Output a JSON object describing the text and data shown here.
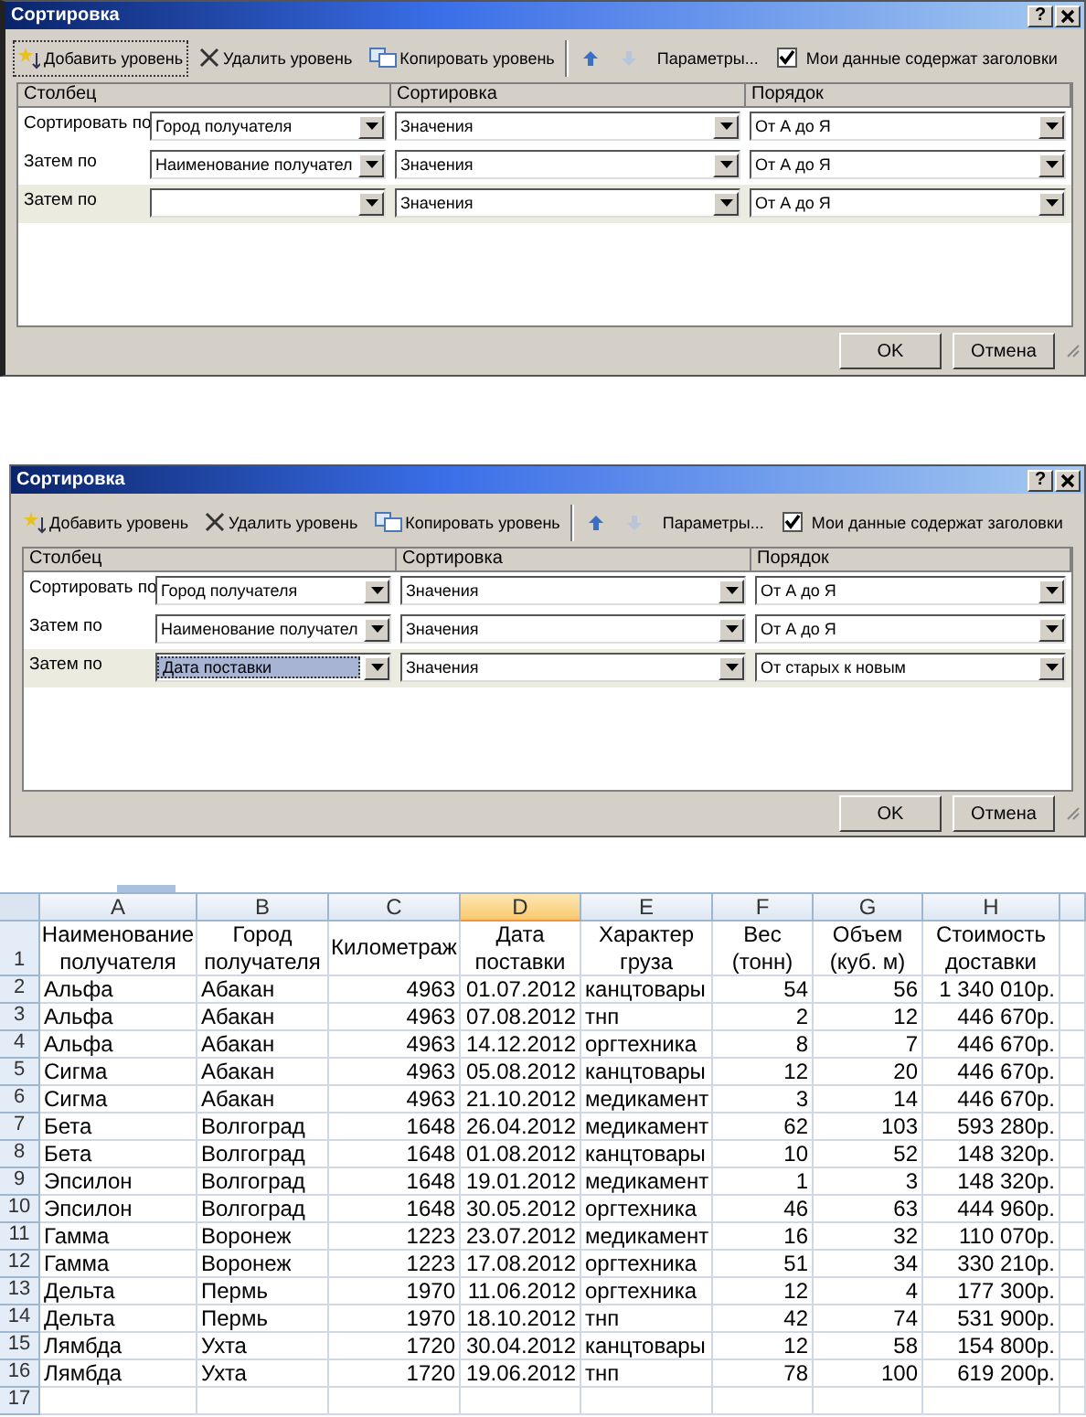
{
  "dialogs": [
    {
      "title": "Сортировка",
      "help": "?",
      "toolbar": [
        {
          "kind": "add",
          "label": "Добавить уровень",
          "focused": true
        },
        {
          "kind": "delete",
          "label": "Удалить уровень"
        },
        {
          "kind": "copy",
          "label": "Копировать уровень"
        },
        {
          "kind": "up",
          "disabled": false
        },
        {
          "kind": "down",
          "disabled": true
        },
        {
          "kind": "options",
          "label": "Параметры..."
        }
      ],
      "headers_checkbox": {
        "label": "Мои данные содержат заголовки",
        "checked": true
      },
      "columns": [
        "Столбец",
        "Сортировка",
        "Порядок"
      ],
      "levels": [
        {
          "label": "Сортировать по",
          "column": "Город получателя",
          "column_text_selected": false,
          "sort_on": "Значения",
          "order": "От А до Я",
          "selected": false
        },
        {
          "label": "Затем по",
          "column": "Наименование получател",
          "column_text_selected": false,
          "sort_on": "Значения",
          "order": "От А до Я",
          "selected": false
        },
        {
          "label": "Затем по",
          "column_text_selected": false,
          "sort_on": "Значения",
          "order": "От А до Я",
          "selected": true
        }
      ],
      "buttons": [
        "OK",
        "Отмена"
      ]
    },
    {
      "title": "Сортировка",
      "help": "?",
      "toolbar": [
        {
          "kind": "add",
          "label": "Добавить уровень",
          "focused": false
        },
        {
          "kind": "delete",
          "label": "Удалить уровень"
        },
        {
          "kind": "copy",
          "label": "Копировать уровень"
        },
        {
          "kind": "up",
          "disabled": false
        },
        {
          "kind": "down",
          "disabled": true
        },
        {
          "kind": "options",
          "label": "Параметры..."
        }
      ],
      "headers_checkbox": {
        "label": "Мои данные содержат заголовки",
        "checked": true
      },
      "columns": [
        "Столбец",
        "Сортировка",
        "Порядок"
      ],
      "levels": [
        {
          "label": "Сортировать по",
          "column": "Город получателя",
          "column_text_selected": false,
          "sort_on": "Значения",
          "order": "От А до Я",
          "selected": false
        },
        {
          "label": "Затем по",
          "column": "Наименование получател",
          "column_text_selected": false,
          "sort_on": "Значения",
          "order": "От А до Я",
          "selected": false
        },
        {
          "label": "Затем по",
          "column": "Дата поставки",
          "column_text_selected": true,
          "sort_on": "Значения",
          "order": "От старых к новым",
          "selected": true
        }
      ],
      "buttons": [
        "OK",
        "Отмена"
      ]
    }
  ],
  "sheet": {
    "columns": [
      {
        "letter": "A",
        "selected": false
      },
      {
        "letter": "B",
        "selected": false
      },
      {
        "letter": "C",
        "selected": false
      },
      {
        "letter": "D",
        "selected": true
      },
      {
        "letter": "E",
        "selected": false
      },
      {
        "letter": "F",
        "selected": false
      },
      {
        "letter": "G",
        "selected": false
      },
      {
        "letter": "H",
        "selected": false
      }
    ],
    "header_row": {
      "number": "1",
      "cells": [
        "Наименование\nполучателя",
        "Город\nполучателя",
        "Километраж",
        "Дата\nпоставки",
        "Характер\nгруза",
        "Вес\n(тонн)",
        "Объем\n(куб. м)",
        "Стоимость\nдоставки"
      ]
    },
    "rows": [
      {
        "number": "2",
        "cells": [
          "Альфа",
          "Абакан",
          "4963",
          "01.07.2012",
          "канцтовары",
          "54",
          "56",
          "1 340 010р."
        ]
      },
      {
        "number": "3",
        "cells": [
          "Альфа",
          "Абакан",
          "4963",
          "07.08.2012",
          "тнп",
          "2",
          "12",
          "446 670р."
        ]
      },
      {
        "number": "4",
        "cells": [
          "Альфа",
          "Абакан",
          "4963",
          "14.12.2012",
          "оргтехника",
          "8",
          "7",
          "446 670р."
        ]
      },
      {
        "number": "5",
        "cells": [
          "Сигма",
          "Абакан",
          "4963",
          "05.08.2012",
          "канцтовары",
          "12",
          "20",
          "446 670р."
        ]
      },
      {
        "number": "6",
        "cells": [
          "Сигма",
          "Абакан",
          "4963",
          "21.10.2012",
          "медикамент",
          "3",
          "14",
          "446 670р."
        ]
      },
      {
        "number": "7",
        "cells": [
          "Бета",
          "Волгоград",
          "1648",
          "26.04.2012",
          "медикамент",
          "62",
          "103",
          "593 280р."
        ]
      },
      {
        "number": "8",
        "cells": [
          "Бета",
          "Волгоград",
          "1648",
          "01.08.2012",
          "канцтовары",
          "10",
          "52",
          "148 320р."
        ]
      },
      {
        "number": "9",
        "cells": [
          "Эпсилон",
          "Волгоград",
          "1648",
          "19.01.2012",
          "медикамент",
          "1",
          "3",
          "148 320р."
        ]
      },
      {
        "number": "10",
        "cells": [
          "Эпсилон",
          "Волгоград",
          "1648",
          "30.05.2012",
          "оргтехника",
          "46",
          "63",
          "444 960р."
        ]
      },
      {
        "number": "11",
        "cells": [
          "Гамма",
          "Воронеж",
          "1223",
          "23.07.2012",
          "медикамент",
          "16",
          "32",
          "110 070р."
        ]
      },
      {
        "number": "12",
        "cells": [
          "Гамма",
          "Воронеж",
          "1223",
          "17.08.2012",
          "оргтехника",
          "51",
          "34",
          "330 210р."
        ]
      },
      {
        "number": "13",
        "cells": [
          "Дельта",
          "Пермь",
          "1970",
          "11.06.2012",
          "оргтехника",
          "12",
          "4",
          "177 300р."
        ]
      },
      {
        "number": "14",
        "cells": [
          "Дельта",
          "Пермь",
          "1970",
          "18.10.2012",
          "тнп",
          "42",
          "74",
          "531 900р."
        ]
      },
      {
        "number": "15",
        "cells": [
          "Лямбда",
          "Ухта",
          "1720",
          "30.04.2012",
          "канцтовары",
          "12",
          "58",
          "154 800р."
        ]
      },
      {
        "number": "16",
        "cells": [
          "Лямбда",
          "Ухта",
          "1720",
          "19.06.2012",
          "тнп",
          "78",
          "100",
          "619 200р."
        ]
      },
      {
        "number": "17"
      }
    ]
  }
}
